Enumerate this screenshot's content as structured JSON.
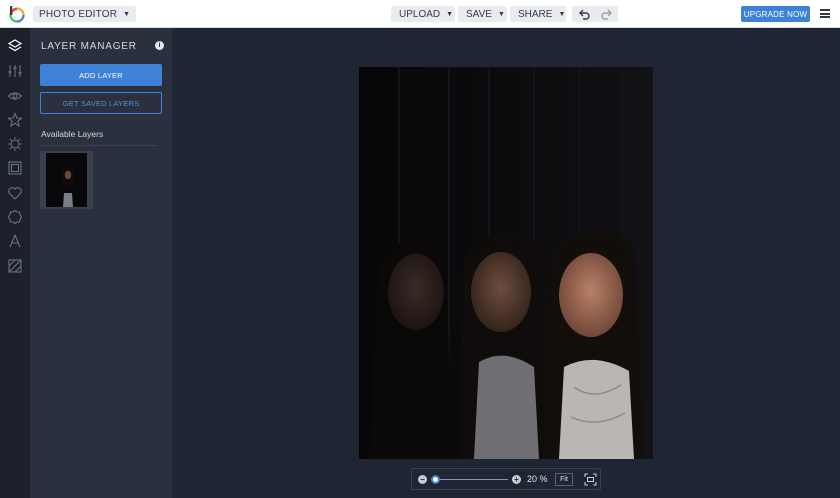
{
  "header": {
    "mode_label": "PHOTO EDITOR",
    "upload_label": "UPLOAD",
    "save_label": "SAVE",
    "share_label": "SHARE",
    "upgrade_label": "UPGRADE NOW"
  },
  "rail": {
    "icons": [
      "layers-icon",
      "sliders-icon",
      "eye-icon",
      "star-icon",
      "gear-icon",
      "frame-icon",
      "heart-icon",
      "badge-icon",
      "text-icon",
      "texture-icon"
    ]
  },
  "panel": {
    "title": "LAYER MANAGER",
    "add_layer_label": "ADD LAYER",
    "get_saved_label": "GET SAVED LAYERS",
    "available_label": "Available Layers"
  },
  "zoom": {
    "value": "20 %",
    "fit_label": "Fit",
    "level_fraction": 0.05
  },
  "colors": {
    "accent": "#3e82d8",
    "topbar": "#ffffff",
    "panel": "#2a303e",
    "rail": "#1b202b",
    "canvas": "#1f2532"
  }
}
